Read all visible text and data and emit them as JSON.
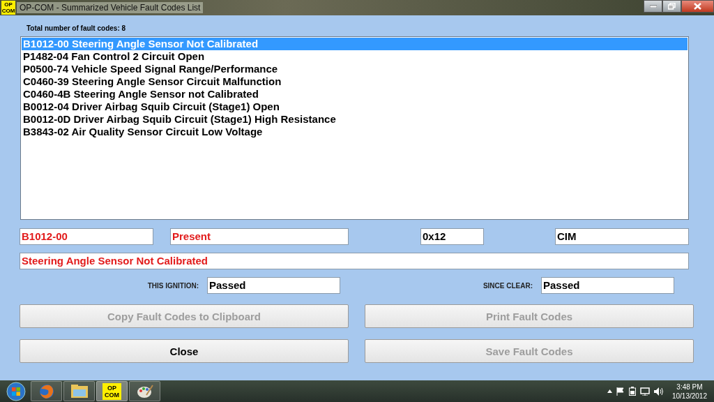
{
  "window": {
    "title": "OP-COM - Summarized Vehicle Fault Codes List",
    "icon_lines": [
      "OP",
      "COM"
    ]
  },
  "summary": "Total number of fault codes: 8",
  "fault_codes": [
    {
      "text": "B1012-00 Steering Angle Sensor Not Calibrated",
      "selected": true
    },
    {
      "text": "P1482-04 Fan Control 2 Circuit Open",
      "selected": false
    },
    {
      "text": "P0500-74 Vehicle Speed Signal Range/Performance",
      "selected": false
    },
    {
      "text": "C0460-39 Steering Angle Sensor Circuit Malfunction",
      "selected": false
    },
    {
      "text": "C0460-4B Steering Angle Sensor not Calibrated",
      "selected": false
    },
    {
      "text": "B0012-04 Driver Airbag Squib Circuit (Stage1) Open",
      "selected": false
    },
    {
      "text": "B0012-0D Driver Airbag Squib Circuit (Stage1) High Resistance",
      "selected": false
    },
    {
      "text": "B3843-02 Air Quality Sensor Circuit Low Voltage",
      "selected": false
    }
  ],
  "details": [
    {
      "value": "B1012-00",
      "kind": "alert"
    },
    {
      "value": "Present",
      "kind": "alert"
    },
    {
      "value": "0x12",
      "kind": "plain"
    },
    {
      "value": "CIM",
      "kind": "plain"
    }
  ],
  "description": {
    "value": "Steering Angle Sensor Not Calibrated",
    "kind": "alert"
  },
  "status": [
    {
      "label": "THIS IGNITION:",
      "value": "Passed"
    },
    {
      "label": "SINCE CLEAR:",
      "value": "Passed"
    }
  ],
  "buttons": [
    {
      "label": "Copy Fault Codes to Clipboard",
      "disabled": true
    },
    {
      "label": "Print Fault Codes",
      "disabled": true
    },
    {
      "label": "Close",
      "disabled": false
    },
    {
      "label": "Save Fault Codes",
      "disabled": true
    }
  ],
  "taskbar": {
    "apps": [
      {
        "kind": "browser"
      },
      {
        "kind": "folder"
      },
      {
        "kind": "opcom",
        "lines": [
          "OP",
          "COM"
        ]
      },
      {
        "kind": "paint"
      }
    ],
    "time": "3:48 PM",
    "date": "10/13/2012"
  }
}
